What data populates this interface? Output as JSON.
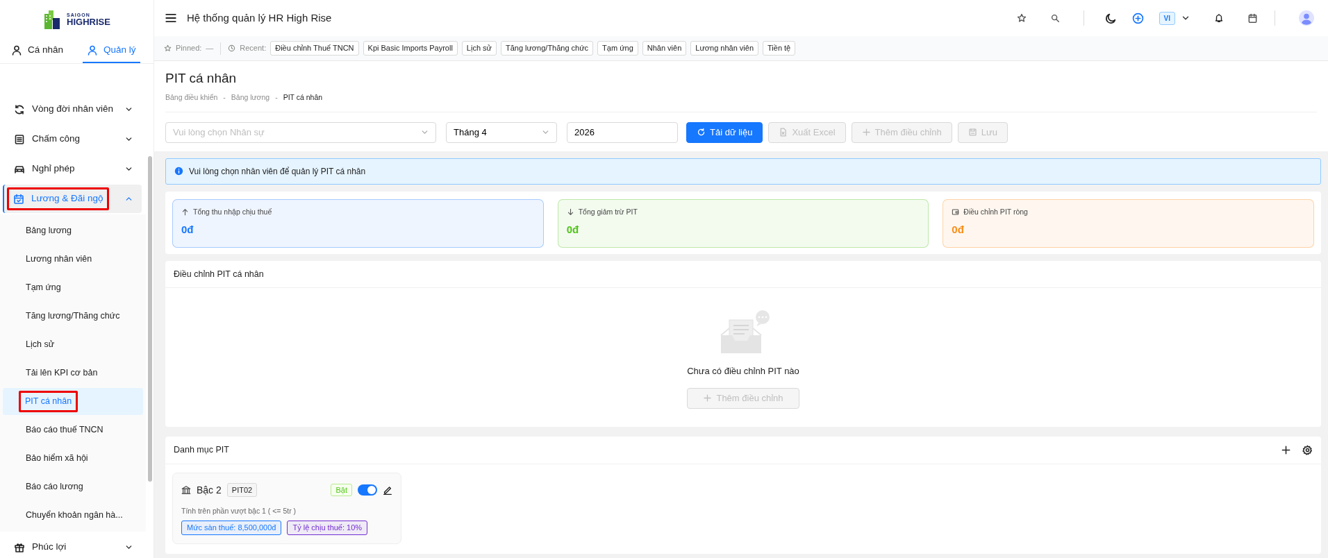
{
  "app": {
    "logo_top": "SAIGON",
    "logo_bottom": "HIGHRISE",
    "title": "Hệ thống quản lý HR High Rise",
    "language": "VI"
  },
  "sidebar": {
    "tabs": [
      {
        "label": "Cá nhân",
        "selected": false
      },
      {
        "label": "Quản lý",
        "selected": true
      }
    ],
    "items": [
      {
        "label": "Vòng đời nhân viên",
        "expanded": false,
        "selected": false,
        "highlighted": false
      },
      {
        "label": "Chấm công",
        "expanded": false,
        "selected": false,
        "highlighted": false
      },
      {
        "label": "Nghỉ phép",
        "expanded": false,
        "selected": false,
        "highlighted": false
      },
      {
        "label": "Lương & Đãi ngộ",
        "expanded": true,
        "selected": true,
        "highlighted": true,
        "children": [
          {
            "label": "Bảng lương",
            "selected": false,
            "highlighted": false
          },
          {
            "label": "Lương nhân viên",
            "selected": false,
            "highlighted": false
          },
          {
            "label": "Tạm ứng",
            "selected": false,
            "highlighted": false
          },
          {
            "label": "Tăng lương/Thăng chức",
            "selected": false,
            "highlighted": false
          },
          {
            "label": "Lịch sử",
            "selected": false,
            "highlighted": false
          },
          {
            "label": "Tải lên KPI cơ bản",
            "selected": false,
            "highlighted": false
          },
          {
            "label": "PIT cá nhân",
            "selected": true,
            "highlighted": true
          },
          {
            "label": "Báo cáo thuế TNCN",
            "selected": false,
            "highlighted": false
          },
          {
            "label": "Bảo hiểm xã hội",
            "selected": false,
            "highlighted": false
          },
          {
            "label": "Báo cáo lương",
            "selected": false,
            "highlighted": false
          },
          {
            "label": "Chuyển khoản ngân hà...",
            "selected": false,
            "highlighted": false
          }
        ]
      },
      {
        "label": "Phúc lợi",
        "expanded": false,
        "selected": false,
        "highlighted": false
      }
    ]
  },
  "quickbar": {
    "pinned_label": "Pinned:",
    "pinned_empty": "—",
    "recent_label": "Recent:",
    "recent": [
      "Điều chỉnh Thuế TNCN",
      "Kpi Basic Imports Payroll",
      "Lịch sử",
      "Tăng lương/Thăng chức",
      "Tạm ứng",
      "Nhân viên",
      "Lương nhân viên",
      "Tiền tệ"
    ]
  },
  "page": {
    "title": "PIT cá nhân",
    "breadcrumb_separators": [
      "-",
      "-"
    ],
    "breadcrumb": [
      {
        "label": "Bảng điều khiển",
        "current": false
      },
      {
        "label": "Bảng lương",
        "current": false
      },
      {
        "label": "PIT cá nhân",
        "current": true
      }
    ]
  },
  "filters": {
    "employee": {
      "placeholder": "Vui lòng chọn Nhân sự"
    },
    "month": {
      "value": "Tháng 4"
    },
    "year": {
      "value": "2026"
    }
  },
  "actions": [
    {
      "label": "Tải dữ liệu",
      "disabled": false
    },
    {
      "label": "Xuất Excel",
      "disabled": true
    },
    {
      "label": "Thêm điều chỉnh",
      "disabled": true
    },
    {
      "label": "Lưu",
      "disabled": true
    }
  ],
  "alert": "Vui lòng chọn nhân viên để quản lý PIT cá nhân",
  "stats": [
    {
      "label": "Tổng thu nhập chịu thuế",
      "value": "0đ",
      "color": "#1677ff"
    },
    {
      "label": "Tổng giảm trừ PIT",
      "value": "0đ",
      "color": "#52c41a"
    },
    {
      "label": "Điều chỉnh PIT ròng",
      "value": "0đ",
      "color": "#fa8c16"
    }
  ],
  "adjustments": {
    "title": "Điều chỉnh PIT cá nhân",
    "empty_text": "Chưa có điều chỉnh PIT nào",
    "add_button": {
      "label": "Thêm điều chỉnh",
      "disabled": true
    }
  },
  "catalog": {
    "title": "Danh mục PIT",
    "items": [
      {
        "name": "Bậc 2",
        "code": "PIT02",
        "status": "Bật",
        "on": true,
        "description": "Tính trên phần vượt bậc 1 ( <= 5tr )",
        "tags": [
          {
            "text": "Mức sàn thuế: 8,500,000đ",
            "color": "#1677ff"
          },
          {
            "text": "Tỷ lệ chịu thuế: 10%",
            "color": "#722ed1"
          }
        ]
      }
    ]
  }
}
